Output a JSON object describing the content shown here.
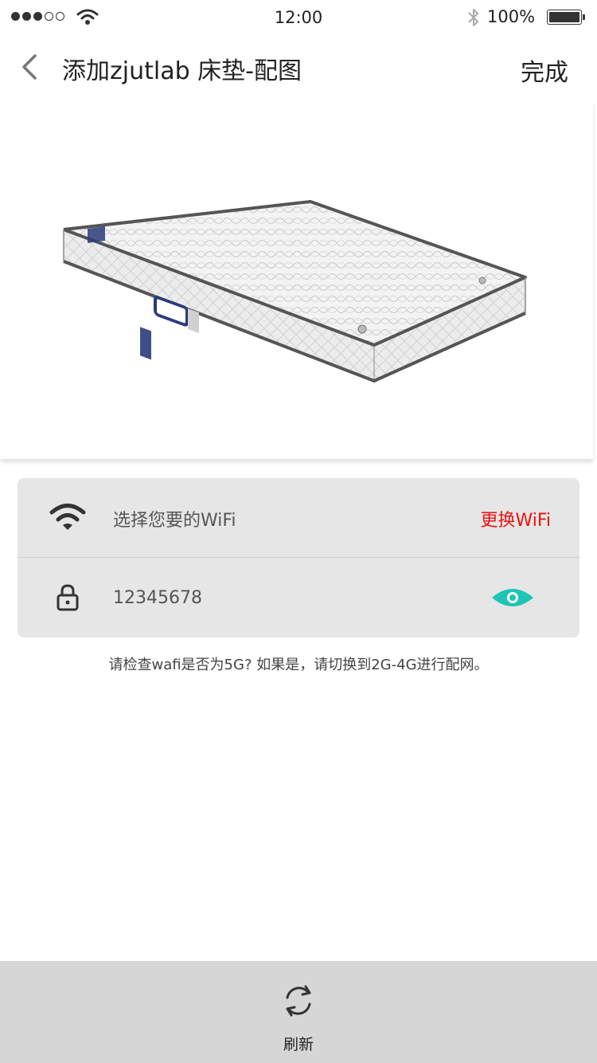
{
  "status_bar": {
    "time": "12:00",
    "battery": "100%",
    "signal_dots": [
      "filled",
      "filled",
      "filled",
      "empty",
      "empty"
    ],
    "icons": [
      "wifi-icon",
      "bluetooth-icon",
      "battery-icon"
    ]
  },
  "nav": {
    "title": "添加zjutlab 床垫-配图",
    "done_label": "完成",
    "back_icon": "chevron-left-icon"
  },
  "product": {
    "image_name": "mattress-image"
  },
  "wifi_form": {
    "select_label": "选择您要的WiFi",
    "change_label": "更换WiFi",
    "password_value": "12345678",
    "icons": [
      "wifi-icon",
      "lock-icon",
      "eye-icon"
    ]
  },
  "hint_text": "请检查wafi是否为5G? 如果是，请切换到2G-4G进行配网。",
  "bottom": {
    "refresh_label": "刷新",
    "refresh_icon": "refresh-icon"
  },
  "colors": {
    "accent_red": "#ee1111",
    "eye_teal": "#1ec5b6",
    "card_bg": "#e6e6e6",
    "bottom_bar_bg": "#d6d6d6"
  }
}
